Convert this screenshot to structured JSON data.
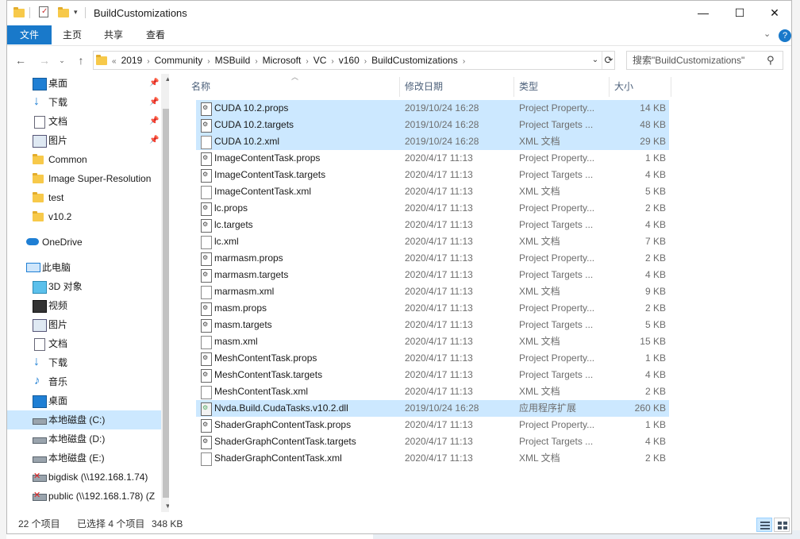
{
  "window": {
    "title": "BuildCustomizations"
  },
  "ribbon": {
    "tabs": [
      "文件",
      "主页",
      "共享",
      "查看"
    ]
  },
  "address": {
    "overflow": "«",
    "crumbs": [
      "2019",
      "Community",
      "MSBuild",
      "Microsoft",
      "VC",
      "v160",
      "BuildCustomizations"
    ]
  },
  "search": {
    "placeholder": "搜索\"BuildCustomizations\""
  },
  "nav": {
    "quick_access": [
      {
        "label": "桌面",
        "icon": "desktop-icon",
        "pinned": true
      },
      {
        "label": "下载",
        "icon": "download-icon",
        "pinned": true
      },
      {
        "label": "文档",
        "icon": "document-icon",
        "pinned": true
      },
      {
        "label": "图片",
        "icon": "picture-icon",
        "pinned": true
      },
      {
        "label": "Common",
        "icon": "folder-icon",
        "pinned": false
      },
      {
        "label": "Image Super-Resolution",
        "icon": "folder-icon",
        "pinned": false
      },
      {
        "label": "test",
        "icon": "folder-icon",
        "pinned": false
      },
      {
        "label": "v10.2",
        "icon": "folder-icon",
        "pinned": false
      }
    ],
    "onedrive": "OneDrive",
    "this_pc": "此电脑",
    "pc_items": [
      {
        "label": "3D 对象",
        "icon": "cube-icon"
      },
      {
        "label": "视频",
        "icon": "video-icon"
      },
      {
        "label": "图片",
        "icon": "picture-icon"
      },
      {
        "label": "文档",
        "icon": "document-icon"
      },
      {
        "label": "下载",
        "icon": "download-icon"
      },
      {
        "label": "音乐",
        "icon": "music-icon"
      },
      {
        "label": "桌面",
        "icon": "desktop-icon"
      },
      {
        "label": "本地磁盘 (C:)",
        "icon": "drive-icon",
        "selected": true
      },
      {
        "label": "本地磁盘 (D:)",
        "icon": "drive-icon"
      },
      {
        "label": "本地磁盘 (E:)",
        "icon": "drive-icon"
      },
      {
        "label": "bigdisk (\\\\192.168.1.74)",
        "icon": "network-drive-icon"
      },
      {
        "label": "public (\\\\192.168.1.78) (Z",
        "icon": "network-drive-icon"
      }
    ]
  },
  "columns": {
    "name": "名称",
    "date": "修改日期",
    "type": "类型",
    "size": "大小"
  },
  "files": [
    {
      "name": "CUDA 10.2.props",
      "date": "2019/10/24 16:28",
      "type": "Project Property...",
      "size": "14 KB",
      "kind": "prop",
      "selected": true
    },
    {
      "name": "CUDA 10.2.targets",
      "date": "2019/10/24 16:28",
      "type": "Project Targets ...",
      "size": "48 KB",
      "kind": "prop",
      "selected": true
    },
    {
      "name": "CUDA 10.2.xml",
      "date": "2019/10/24 16:28",
      "type": "XML 文档",
      "size": "29 KB",
      "kind": "xml",
      "selected": true
    },
    {
      "name": "ImageContentTask.props",
      "date": "2020/4/17 11:13",
      "type": "Project Property...",
      "size": "1 KB",
      "kind": "prop"
    },
    {
      "name": "ImageContentTask.targets",
      "date": "2020/4/17 11:13",
      "type": "Project Targets ...",
      "size": "4 KB",
      "kind": "prop"
    },
    {
      "name": "ImageContentTask.xml",
      "date": "2020/4/17 11:13",
      "type": "XML 文档",
      "size": "5 KB",
      "kind": "xml"
    },
    {
      "name": "lc.props",
      "date": "2020/4/17 11:13",
      "type": "Project Property...",
      "size": "2 KB",
      "kind": "prop"
    },
    {
      "name": "lc.targets",
      "date": "2020/4/17 11:13",
      "type": "Project Targets ...",
      "size": "4 KB",
      "kind": "prop"
    },
    {
      "name": "lc.xml",
      "date": "2020/4/17 11:13",
      "type": "XML 文档",
      "size": "7 KB",
      "kind": "xml"
    },
    {
      "name": "marmasm.props",
      "date": "2020/4/17 11:13",
      "type": "Project Property...",
      "size": "2 KB",
      "kind": "prop"
    },
    {
      "name": "marmasm.targets",
      "date": "2020/4/17 11:13",
      "type": "Project Targets ...",
      "size": "4 KB",
      "kind": "prop"
    },
    {
      "name": "marmasm.xml",
      "date": "2020/4/17 11:13",
      "type": "XML 文档",
      "size": "9 KB",
      "kind": "xml"
    },
    {
      "name": "masm.props",
      "date": "2020/4/17 11:13",
      "type": "Project Property...",
      "size": "2 KB",
      "kind": "prop"
    },
    {
      "name": "masm.targets",
      "date": "2020/4/17 11:13",
      "type": "Project Targets ...",
      "size": "5 KB",
      "kind": "prop"
    },
    {
      "name": "masm.xml",
      "date": "2020/4/17 11:13",
      "type": "XML 文档",
      "size": "15 KB",
      "kind": "xml"
    },
    {
      "name": "MeshContentTask.props",
      "date": "2020/4/17 11:13",
      "type": "Project Property...",
      "size": "1 KB",
      "kind": "prop"
    },
    {
      "name": "MeshContentTask.targets",
      "date": "2020/4/17 11:13",
      "type": "Project Targets ...",
      "size": "4 KB",
      "kind": "prop"
    },
    {
      "name": "MeshContentTask.xml",
      "date": "2020/4/17 11:13",
      "type": "XML 文档",
      "size": "2 KB",
      "kind": "xml"
    },
    {
      "name": "Nvda.Build.CudaTasks.v10.2.dll",
      "date": "2019/10/24 16:28",
      "type": "应用程序扩展",
      "size": "260 KB",
      "kind": "dll",
      "selected": true
    },
    {
      "name": "ShaderGraphContentTask.props",
      "date": "2020/4/17 11:13",
      "type": "Project Property...",
      "size": "1 KB",
      "kind": "prop"
    },
    {
      "name": "ShaderGraphContentTask.targets",
      "date": "2020/4/17 11:13",
      "type": "Project Targets ...",
      "size": "4 KB",
      "kind": "prop"
    },
    {
      "name": "ShaderGraphContentTask.xml",
      "date": "2020/4/17 11:13",
      "type": "XML 文档",
      "size": "2 KB",
      "kind": "xml"
    }
  ],
  "status": {
    "item_count": "22 个项目",
    "selection": "已选择 4 个项目",
    "selection_size": "348 KB"
  },
  "colors": {
    "accent": "#1979ca",
    "selection": "#cce8ff",
    "folder": "#f7c94a"
  }
}
